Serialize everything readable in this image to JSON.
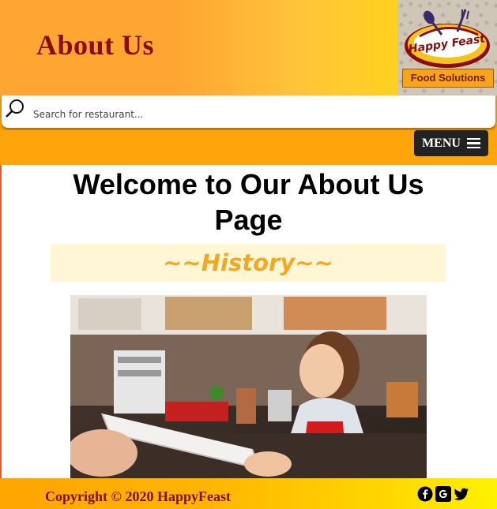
{
  "header": {
    "title": "About Us",
    "logo": {
      "brand": "Happy Feast",
      "tagline": "Food Solutions"
    }
  },
  "search": {
    "placeholder": "Search for restaurant...",
    "value": ""
  },
  "nav": {
    "menu_label": "MENU"
  },
  "main": {
    "welcome": "Welcome to Our About Us Page",
    "section_title": "~~History~~"
  },
  "footer": {
    "copyright": "Copyright © 2020 HappyFeast",
    "social": [
      "facebook-icon",
      "google-icon",
      "twitter-icon"
    ]
  },
  "colors": {
    "header_orange": "#ffa632",
    "nav_orange": "#ffa50c",
    "title_red": "#8b0c0c",
    "history_gold": "#f5a623",
    "history_bg": "#fff6d6"
  }
}
